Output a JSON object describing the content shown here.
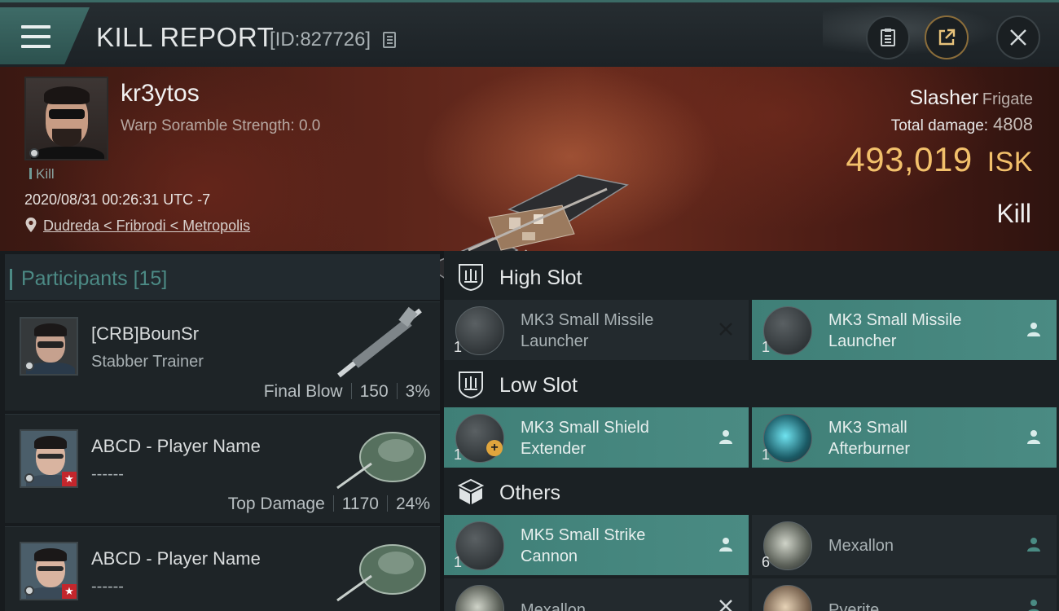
{
  "header": {
    "title": "KILL REPORT",
    "report_id": "[ID:827726]"
  },
  "victim": {
    "name": "kr3ytos",
    "scramble": "Warp Soramble Strength: 0.0",
    "kill_tag": "Kill",
    "datetime": "2020/08/31 00:26:31 UTC -7",
    "location": "Dudreda < Fribrodi < Metropolis",
    "ship_name": "Slasher",
    "ship_class": "Frigate",
    "total_damage_label": "Total damage:",
    "total_damage": "4808",
    "isk_value": "493,019",
    "isk_currency": "ISK",
    "result": "Kill"
  },
  "participants": {
    "label": "Participants",
    "count": "[15]",
    "rows": [
      {
        "name": "[CRB]BounSr",
        "sub": "Stabber Trainer",
        "role": "Final Blow",
        "damage": "150",
        "percent": "3%"
      },
      {
        "name": "ABCD - Player Name",
        "sub": "------",
        "role": "Top Damage",
        "damage": "1170",
        "percent": "24%"
      },
      {
        "name": "ABCD - Player Name",
        "sub": "------"
      }
    ]
  },
  "fitting": {
    "high_slot": "High Slot",
    "low_slot": "Low Slot",
    "others": "Others",
    "items": [
      {
        "name_line1": "MK3 Small Missile",
        "name_line2": "Launcher",
        "qty": "1",
        "status": "destroyed"
      },
      {
        "name_line1": "MK3 Small Missile",
        "name_line2": "Launcher",
        "qty": "1",
        "status": "dropped"
      },
      {
        "name_line1": "MK3 Small Shield",
        "name_line2": "Extender",
        "qty": "1",
        "status": "dropped"
      },
      {
        "name_line1": "MK3 Small",
        "name_line2": "Afterburner",
        "qty": "1",
        "status": "dropped"
      },
      {
        "name_line1": "MK5 Small Strike",
        "name_line2": "Cannon",
        "qty": "1",
        "status": "dropped"
      },
      {
        "name_line1": "Mexallon",
        "name_line2": "",
        "qty": "6",
        "status": "dropped"
      },
      {
        "name_line1": "Mexallon",
        "name_line2": "",
        "qty": "",
        "status": "destroyed"
      },
      {
        "name_line1": "Pyerite",
        "name_line2": "",
        "qty": "",
        "status": "dropped"
      }
    ]
  },
  "colors": {
    "accent_teal": "#4a8b83",
    "isk_gold": "#f2c06b",
    "badge_red": "#c3262c"
  }
}
